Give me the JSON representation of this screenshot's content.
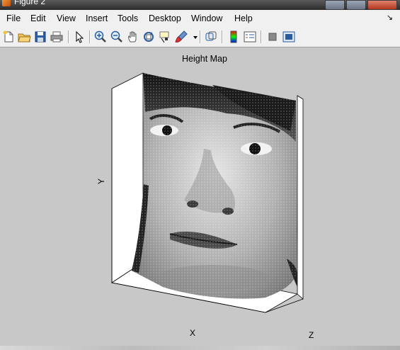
{
  "window": {
    "title": "Figure 2"
  },
  "menu": {
    "items": [
      "File",
      "Edit",
      "View",
      "Insert",
      "Tools",
      "Desktop",
      "Window",
      "Help"
    ],
    "dock_glyph": "↘"
  },
  "toolbar": {
    "buttons": [
      "new-figure-icon",
      "open-file-icon",
      "save-figure-icon",
      "print-figure-icon",
      "edit-plot-icon",
      "zoom-in-icon",
      "zoom-out-icon",
      "pan-icon",
      "rotate-3d-icon",
      "data-cursor-icon",
      "brush-icon",
      "link-plot-icon",
      "insert-colorbar-icon",
      "insert-legend-icon",
      "hide-plot-tools-icon",
      "show-plot-tools-icon"
    ]
  },
  "plot": {
    "title": "Height Map",
    "xlabel": "X",
    "ylabel": "Y",
    "zlabel": "Z",
    "surface": "grayscale face height map, 3D surface plot with white mesh"
  },
  "colors": {
    "figure_bg": "#c8c8c8",
    "menubar_bg": "#f0f0f0",
    "axes_face": "#ffffff"
  }
}
